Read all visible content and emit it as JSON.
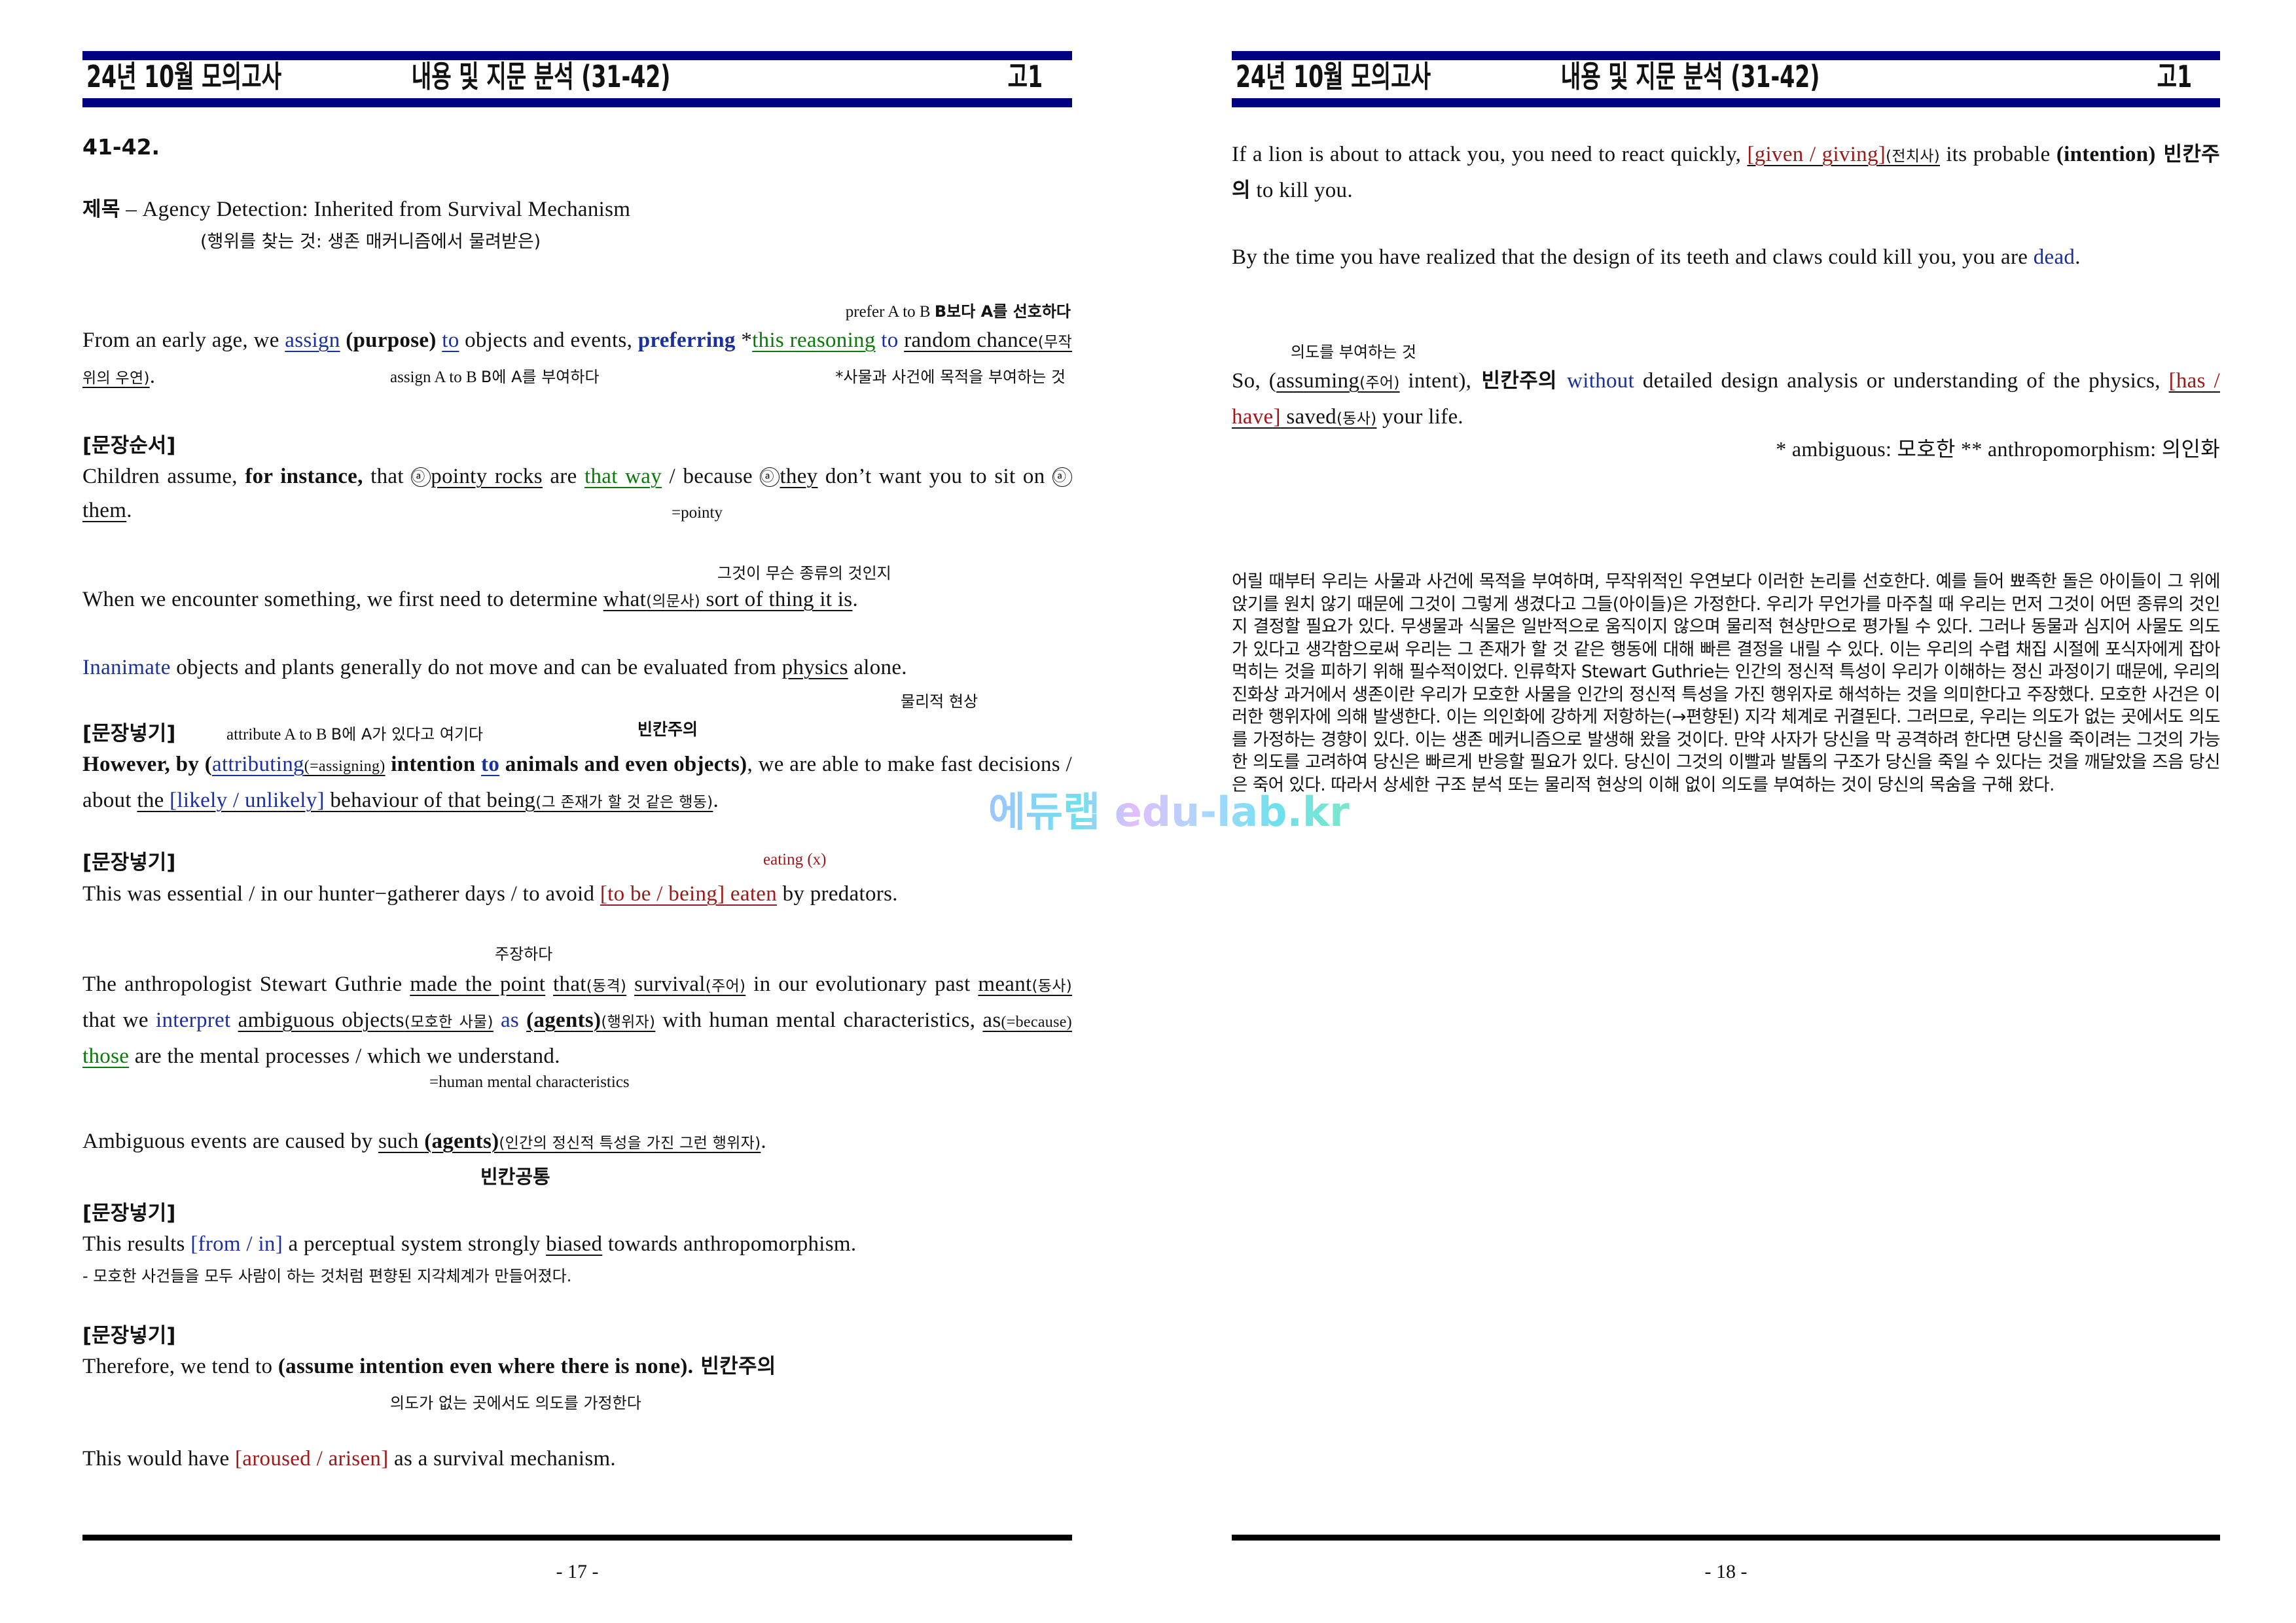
{
  "header": {
    "left": "24년 10월 모의고사",
    "center": "내용 및 지문 분석 (31-42)",
    "right": "고1",
    "bar_color": "#000080"
  },
  "colors": {
    "blue": "#1a2fa0",
    "green": "#0a7a0a",
    "red": "#a01818"
  },
  "left_page": {
    "page_number": "- 17 -",
    "question_number": "41-42.",
    "title": {
      "label": "제목",
      "dash": " – ",
      "en": "Agency Detection: Inherited from Survival Mechanism",
      "ko": "(행위를 찾는 것: 생존 매커니즘에서 물려받은)"
    },
    "s1": {
      "note_above": "prefer A to B",
      "note_above_ko": "B보다 A를 선호하다",
      "t1": "From an early age, we ",
      "assign": "assign",
      "purpose": "(purpose)",
      "to1": "to",
      "t2": " objects and events, ",
      "preferring": "preferring",
      "star": " *",
      "this_reasoning": "this reasoning",
      "to2": "to",
      "random_chance": "random chance",
      "random_chance_ko": "(무작위의 우연)",
      "period": ".",
      "note_below_1": "assign A to B",
      "note_below_1_ko": "B에 A를 부여하다",
      "note_below_2": "*사물과 사건에 목적을 부여하는 것"
    },
    "sec_order": "[문장순서]",
    "s2": {
      "t1": "Children assume, ",
      "for_instance": "for instance,",
      "t2": " that ",
      "circle": "ⓐ",
      "pointy_rocks": "pointy rocks",
      "t3": " are ",
      "that_way": "that way",
      "t4": " / because ",
      "they": "they",
      "t5": " don’t want you to sit on ",
      "them": "them",
      "period": ".",
      "note_below": "=pointy"
    },
    "s3": {
      "note_above": "그것이 무슨 종류의 것인지",
      "t1": "When we encounter something, we first need to determine ",
      "what": "what",
      "what_ko": "(의문사)",
      "rest": " sort of thing it is",
      "period": "."
    },
    "s4": {
      "inanimate": "Inanimate",
      "t1": " objects and plants generally do not move and can be evaluated from ",
      "physics": "physics",
      "t2": " alone.",
      "note_below": "물리적 현상"
    },
    "sec_insert_1": "[문장넣기]",
    "s5": {
      "note_inline": "attribute A to B",
      "note_inline_ko": "B에 A가 있다고 여기다",
      "blank_note": "빈칸주의",
      "t1": "However, by (",
      "attributing": "attributing",
      "assigning": "(=assigning)",
      "t2": " intention ",
      "to": "to",
      "t3": " animals and even objects)",
      "t4": ", we are able to make fast decisions / about ",
      "the": "the ",
      "choice": "[likely / unlikely]",
      "t5": " behaviour of that being",
      "being_ko": "(그 존재가 할 것 같은 행동)",
      "period": "."
    },
    "sec_insert_2": "[문장넣기]",
    "s6": {
      "note_above": "eating (x)",
      "t1": "This was essential / in our hunter−gatherer days / to avoid ",
      "choice": "[to be / being]",
      "eaten": " eaten",
      "t2": " by predators."
    },
    "s7": {
      "note_above": "주장하다",
      "t1": "The anthropologist Stewart Guthrie ",
      "made_the_point": "made the point",
      "that": "that",
      "that_ko": "(동격)",
      "survival": "survival",
      "survival_ko": "(주어)",
      "t2": " in our evolutionary past ",
      "meant": "meant",
      "meant_ko": "(동사)",
      "t3": " that we ",
      "interpret": "interpret",
      "ambiguous_objects": "ambiguous objects",
      "ambiguous_objects_ko": "(모호한 사물)",
      "as": "as",
      "agents": "(agents)",
      "agents_ko": "(행위자)",
      "t4": " with human mental characteristics, ",
      "as2": "as",
      "because": "(=because)",
      "those": "those",
      "t5": " are the mental processes / which we understand.",
      "note_below": "=human mental characteristics"
    },
    "s8": {
      "t1": "Ambiguous events are caused by ",
      "such": "such ",
      "agents": "(agents)",
      "agents_ko": "(인간의 정신적 특성을 가진 그런 행위자)",
      "period": ".",
      "blank_common": "빈칸공통"
    },
    "sec_insert_3": "[문장넣기]",
    "s9": {
      "t1": "This results ",
      "choice": "[from / in]",
      "t2": " a perceptual system strongly ",
      "biased": "biased",
      "t3": " towards anthropomorphism.",
      "translation": "- 모호한 사건들을 모두 사람이 하는 것처럼 편향된 지각체계가 만들어졌다."
    },
    "sec_insert_4": "[문장넣기]",
    "s10": {
      "t1": "Therefore, we tend to ",
      "bold": "(assume intention even where there is none).",
      "blank_note": " 빈칸주의",
      "note_below": "의도가 없는 곳에서도 의도를 가정한다"
    },
    "s11": {
      "t1": "This would have ",
      "choice": "[aroused / arisen]",
      "t2": " as a survival mechanism."
    }
  },
  "right_page": {
    "page_number": "- 18 -",
    "r1": {
      "t1": "If a lion is about to attack you, you need to react quickly, ",
      "choice": "[given / giving]",
      "choice_ko": "(전치사)",
      "t2": " its probable ",
      "intention": "(intention)",
      "blank_note": " 빈칸주의",
      "t3": " to kill you."
    },
    "r2": {
      "t1": "By the time you have realized that the design of its teeth and claws could kill you, you are ",
      "dead": "dead",
      "period": "."
    },
    "r3": {
      "note_above": "의도를 부여하는 것",
      "t1": "So, (",
      "assuming": "assuming",
      "assuming_ko": "(주어)",
      "t2": " intent),",
      "blank_note": " 빈칸주의 ",
      "without": "without",
      "t3": " detailed design analysis or understanding of the physics, ",
      "choice": "[has / have]",
      "saved": " saved",
      "saved_ko": "(동사)",
      "t4": " your life."
    },
    "glossary": "* ambiguous: 모호한 ** anthropomorphism: 의인화",
    "korean_translation": "어릴 때부터 우리는 사물과 사건에 목적을 부여하며, 무작위적인 우연보다 이러한 논리를 선호한다. 예를 들어 뾰족한 돌은 아이들이 그 위에 앉기를 원치 않기 때문에 그것이 그렇게 생겼다고 그들(아이들)은 가정한다. 우리가 무언가를 마주칠 때 우리는 먼저 그것이 어떤 종류의 것인지 결정할 필요가 있다. 무생물과 식물은 일반적으로 움직이지 않으며 물리적 현상만으로 평가될 수 있다. 그러나 동물과 심지어 사물도 의도가 있다고 생각함으로써 우리는 그 존재가 할 것 같은 행동에 대해 빠른 결정을 내릴 수 있다. 이는 우리의 수렵 채집 시절에 포식자에게 잡아먹히는 것을 피하기 위해 필수적이었다. 인류학자 Stewart Guthrie는 인간의 정신적 특성이 우리가 이해하는 정신 과정이기 때문에, 우리의 진화상 과거에서 생존이란 우리가 모호한 사물을 인간의 정신적 특성을 가진 행위자로 해석하는 것을 의미한다고 주장했다. 모호한 사건은 이러한 행위자에 의해 발생한다. 이는 의인화에 강하게 저항하는(→편향된) 지각 체계로 귀결된다. 그러므로, 우리는 의도가 없는 곳에서도 의도를 가정하는 경향이 있다. 이는 생존 메커니즘으로 발생해 왔을 것이다. 만약 사자가 당신을 막 공격하려 한다면 당신을 죽이려는 그것의 가능한 의도를 고려하여 당신은 빠르게 반응할 필요가 있다. 당신이 그것의 이빨과 발톱의 구조가 당신을 죽일 수 있다는 것을 깨달았을 즈음 당신은 죽어 있다. 따라서 상세한 구조 분석 또는 물리적 현상의 이해 없이 의도를 부여하는 것이 당신의 목숨을 구해 왔다."
  },
  "watermark": "에듀랩 edu-lab.kr"
}
